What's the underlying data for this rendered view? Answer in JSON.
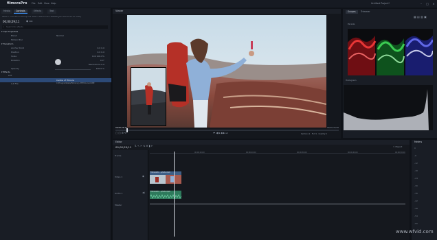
{
  "app": {
    "name": "filmoraPro",
    "project_title": "Untitled Project*"
  },
  "menu": [
    "File",
    "Edit",
    "View",
    "Help"
  ],
  "document_title": "Belize • FilmoraPro PhotoUp Tour Skies • New Product Release (part 006 00:00:10 Video)",
  "left_panel": {
    "tabs": [
      "Media",
      "Controls",
      "Effects",
      "Text"
    ],
    "active_tab": "Controls",
    "breadcrumb": "Belize • FilmoraPro PhotoUp Tour Skies • New Product Release (part 006 00:00:10 Video)",
    "timecode": "00;00;29;11",
    "search_placeholder": "Search for effects",
    "rows": [
      {
        "label": "Clip Properties",
        "value": "",
        "section": true
      },
      {
        "label": "Blend",
        "value": "Normal",
        "section": false
      },
      {
        "label": "Motion Blur",
        "value": "",
        "section": false
      },
      {
        "label": "Transform",
        "value": "",
        "section": true
      },
      {
        "label": "Anchor Point",
        "value": "0.0   0.0",
        "section": false
      },
      {
        "label": "Position",
        "value": "0.0   0.0",
        "section": false
      },
      {
        "label": "Scale",
        "value": "100   100.0%",
        "section": false
      },
      {
        "label": "Rotation",
        "value": "0.0°",
        "section": false
      },
      {
        "label": "",
        "value": "Revolutions  0.0",
        "section": false
      },
      {
        "label": "Opacity",
        "value": "100.0 %",
        "section": false
      },
      {
        "label": "Effects",
        "value": "",
        "section": true
      },
      {
        "label": "LUT",
        "value": "",
        "section": false
      },
      {
        "label": "",
        "value": "Centre of Filmora",
        "section": false
      },
      {
        "label": "Lut File",
        "value": "C:/ProgramData/Filmora_LUT/Filmora.CUBE",
        "section": false
      }
    ]
  },
  "viewer": {
    "title": "Viewer",
    "timecode_left": "00;00;29;11",
    "timecode_right": "00;00;33;06",
    "options_label": "Options",
    "fit_label": "Full",
    "quality_label": "Quality"
  },
  "scopes": {
    "tabs": [
      "Scopes",
      "Trimmer"
    ],
    "parade_label": "Parade",
    "histogram_label": "Histogram"
  },
  "editor": {
    "title": "Editor",
    "timecode": "00;00;29;11",
    "export_label": "Export",
    "ruler_labels": [
      "00;00;10;00",
      "00;00;20;00",
      "00;00;30;00",
      "00;00;40;00",
      "00;00;50;00",
      "00;01;00;00"
    ],
    "tracks": [
      "Tracks",
      "Video 1",
      "Audio 1",
      "Master"
    ],
    "clip_video_label": "FilmoraPro ...photo.mp4",
    "clip_audio_label": "FilmoraPro ...photo.mp4"
  },
  "meters": {
    "title": "Meters",
    "ticks": [
      "0",
      "-6",
      "-12",
      "-18",
      "-24",
      "-30",
      "-36",
      "-42",
      "-48",
      "-54",
      "-60"
    ]
  },
  "colors": {
    "accent": "#3b8df0",
    "bg": "#0f1218",
    "panel": "#191d25",
    "video_clip": "#3f5f86",
    "audio_clip": "#2e7a5c"
  },
  "watermark": "www.wfvid.com"
}
